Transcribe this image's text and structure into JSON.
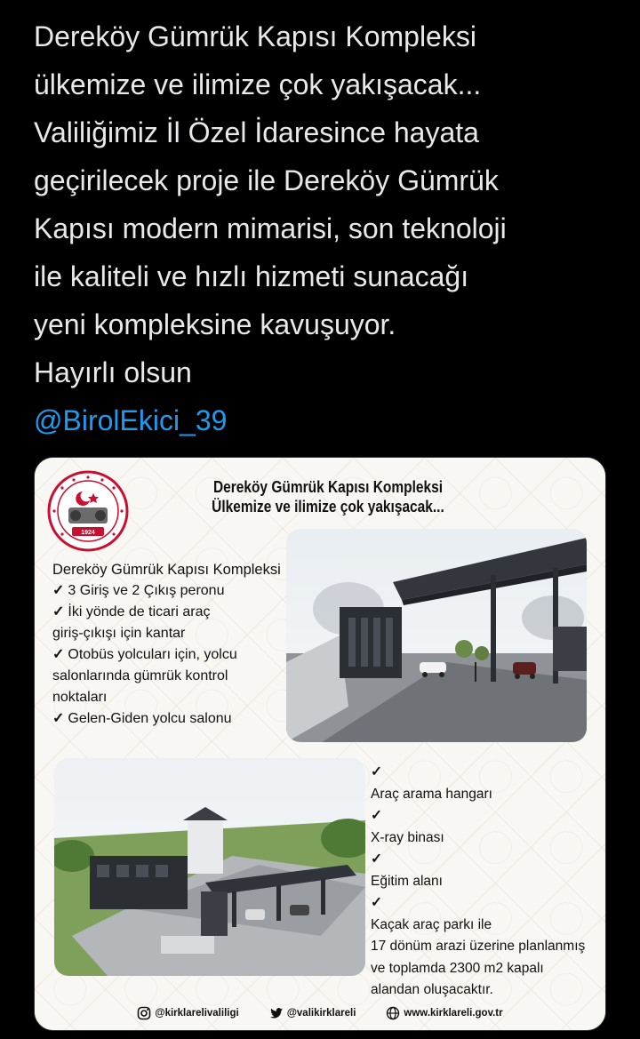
{
  "tweet": {
    "lines": [
      "Dereköy Gümrük Kapısı Kompleksi",
      "ülkemize ve ilimize çok yakışacak...",
      "Valiliğimiz İl Özel İdaresince hayata",
      "geçirilecek proje ile Dereköy Gümrük",
      "Kapısı modern mimarisi, son teknoloji",
      "ile kaliteli ve hızlı hizmeti sunacağı",
      "yeni kompleksine kavuşuyor.",
      "Hayırlı olsun"
    ],
    "mention": "@BirolEkici_39"
  },
  "poster": {
    "title_line1": "Dereköy Gümrük Kapısı Kompleksi",
    "title_line2": "Ülkemize ve ilimize çok yakışacak...",
    "seal_year": "1924",
    "left_heading": "Dereköy Gümrük Kapısı Kompleksi",
    "check_mark": "✓",
    "left_items": [
      "3 Giriş ve 2 Çıkış peronu",
      "İki yönde de ticari araç",
      "giriş-çıkışı için kantar",
      "Otobüs yolcuları için, yolcu",
      "salonlarında gümrük kontrol",
      "noktaları",
      "Gelen-Giden yolcu salonu"
    ],
    "right_items": [
      "Araç arama hangarı",
      "X-ray binası",
      "Eğitim alanı",
      "Kaçak araç parkı ile",
      "17 dönüm arazi üzerine planlanmış",
      "ve toplamda 2300 m2 kapalı",
      "alandan oluşacaktır."
    ],
    "footer": {
      "instagram": "@kirklarelivaliligi",
      "twitter": "@valikirklareli",
      "website": "www.kirklareli.gov.tr"
    }
  },
  "colors": {
    "background": "#000000",
    "text": "#e7e9ea",
    "mention": "#1d9bf0",
    "poster_bg": "#f8f7f3",
    "seal_red": "#c8102e"
  }
}
